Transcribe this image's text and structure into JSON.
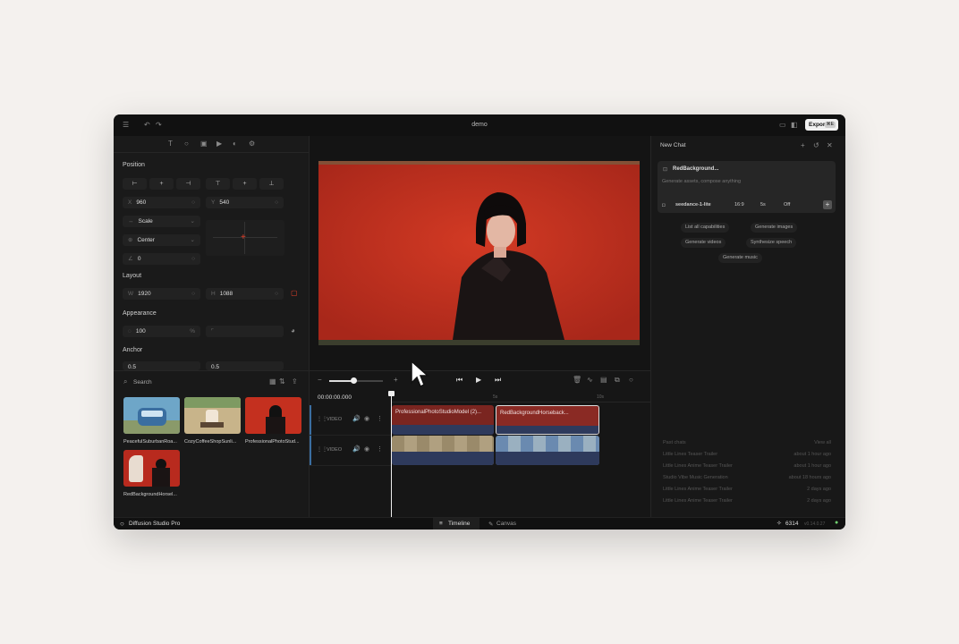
{
  "window": {
    "title": "demo"
  },
  "titlebar": {
    "export_label": "Export",
    "export_shortcut": "⌘E",
    "menu_icon": "menu-icon",
    "undo_icon": "undo-icon",
    "redo_icon": "redo-icon"
  },
  "properties": {
    "position_title": "Position",
    "x_prefix": "X",
    "x_value": "960",
    "y_prefix": "Y",
    "y_value": "540",
    "scale_label": "Scale",
    "center_label": "Center",
    "rotation_value": "0",
    "layout_title": "Layout",
    "w_prefix": "W",
    "w_value": "1920",
    "h_prefix": "H",
    "h_value": "1088",
    "appearance_title": "Appearance",
    "opacity_value": "100",
    "opacity_unit": "%",
    "anchor_title": "Anchor",
    "anchor_x": "0.5",
    "anchor_y": "0.5"
  },
  "media": {
    "search_placeholder": "Search",
    "items": [
      {
        "label": "PeacefulSuburbanRoa..."
      },
      {
        "label": "CozyCoffeeShopSunli..."
      },
      {
        "label": "ProfessionalPhotoStud..."
      },
      {
        "label": "RedBackgroundHorsel..."
      }
    ]
  },
  "timeline": {
    "timecode": "00:00:00.000",
    "ruler": [
      "5s",
      "10s"
    ],
    "tracks": [
      {
        "label": "VIDEO",
        "clips": [
          "ProfessionalPhotoStudioModel (2)...",
          "RedBackgroundHorseback..."
        ]
      },
      {
        "label": "VIDEO",
        "clips": [
          "",
          ""
        ]
      }
    ]
  },
  "chat": {
    "title": "New Chat",
    "prompt_chip": "RedBackground...",
    "placeholder": "Generate assets, compose anything",
    "model": "seedance-1-lite",
    "ratio": "16:9",
    "duration": "5s",
    "audio": "Off",
    "suggestions": [
      "List all capabilities",
      "Generate images",
      "Generate videos",
      "Synthesize speech",
      "Generate music"
    ],
    "past_title": "Past chats",
    "view_all": "View all",
    "past": [
      {
        "name": "Little Lines Teaser Trailer",
        "time": "about 1 hour ago"
      },
      {
        "name": "Little Lines Anime Teaser Trailer",
        "time": "about 1 hour ago"
      },
      {
        "name": "Studio Vibe Music Generation",
        "time": "about 18 hours ago"
      },
      {
        "name": "Little Lines Anime Teaser Trailer",
        "time": "2 days ago"
      },
      {
        "name": "Little Lines Anime Teaser Trailer",
        "time": "2 days ago"
      }
    ]
  },
  "status": {
    "brand": "Diffusion Studio Pro",
    "tab_timeline": "Timeline",
    "tab_canvas": "Canvas",
    "credits": "6314",
    "version": "v0.14.0.27"
  },
  "colors": {
    "accent": "#e8402a",
    "clip_red": "#8a2a24",
    "clip_blue": "#2e3a5c"
  }
}
